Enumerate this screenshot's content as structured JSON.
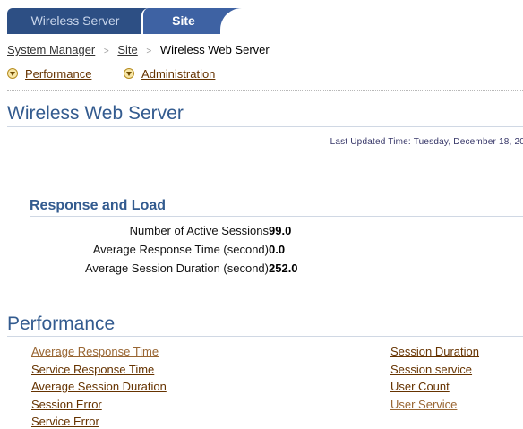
{
  "tabs": {
    "wireless_server": "Wireless Server",
    "site": "Site"
  },
  "breadcrumb": {
    "item1": "System Manager",
    "item2": "Site",
    "current": "Wireless Web Server",
    "separator": ">"
  },
  "quick_links": {
    "performance": "Performance",
    "administration": "Administration"
  },
  "page": {
    "title": "Wireless Web Server",
    "last_updated": "Last Updated Time: Tuesday, December 18, 20"
  },
  "response_and_load": {
    "title": "Response and Load",
    "metrics": [
      {
        "label": "Number of Active Sessions",
        "value": "99.0"
      },
      {
        "label": "Average Response Time (second)",
        "value": "0.0"
      },
      {
        "label": "Average Session Duration (second)",
        "value": "252.0"
      }
    ]
  },
  "performance": {
    "title": "Performance",
    "left_links": [
      {
        "label": "Average Response Time",
        "style": "visited"
      },
      {
        "label": "Service Response Time",
        "style": "normal"
      },
      {
        "label": "Average Session Duration",
        "style": "normal"
      },
      {
        "label": "Session Error",
        "style": "normal"
      },
      {
        "label": "Service Error",
        "style": "normal"
      }
    ],
    "right_links": [
      {
        "label": "Session Duration",
        "style": "normal"
      },
      {
        "label": "Session service",
        "style": "normal"
      },
      {
        "label": "User Count",
        "style": "normal"
      },
      {
        "label": "User Service",
        "style": "visited"
      }
    ]
  },
  "colors": {
    "tab_bar": "#2d4f84",
    "active_tab": "#3e62a3",
    "heading": "#335b8f",
    "link": "#663300",
    "visited_link": "#996633"
  }
}
